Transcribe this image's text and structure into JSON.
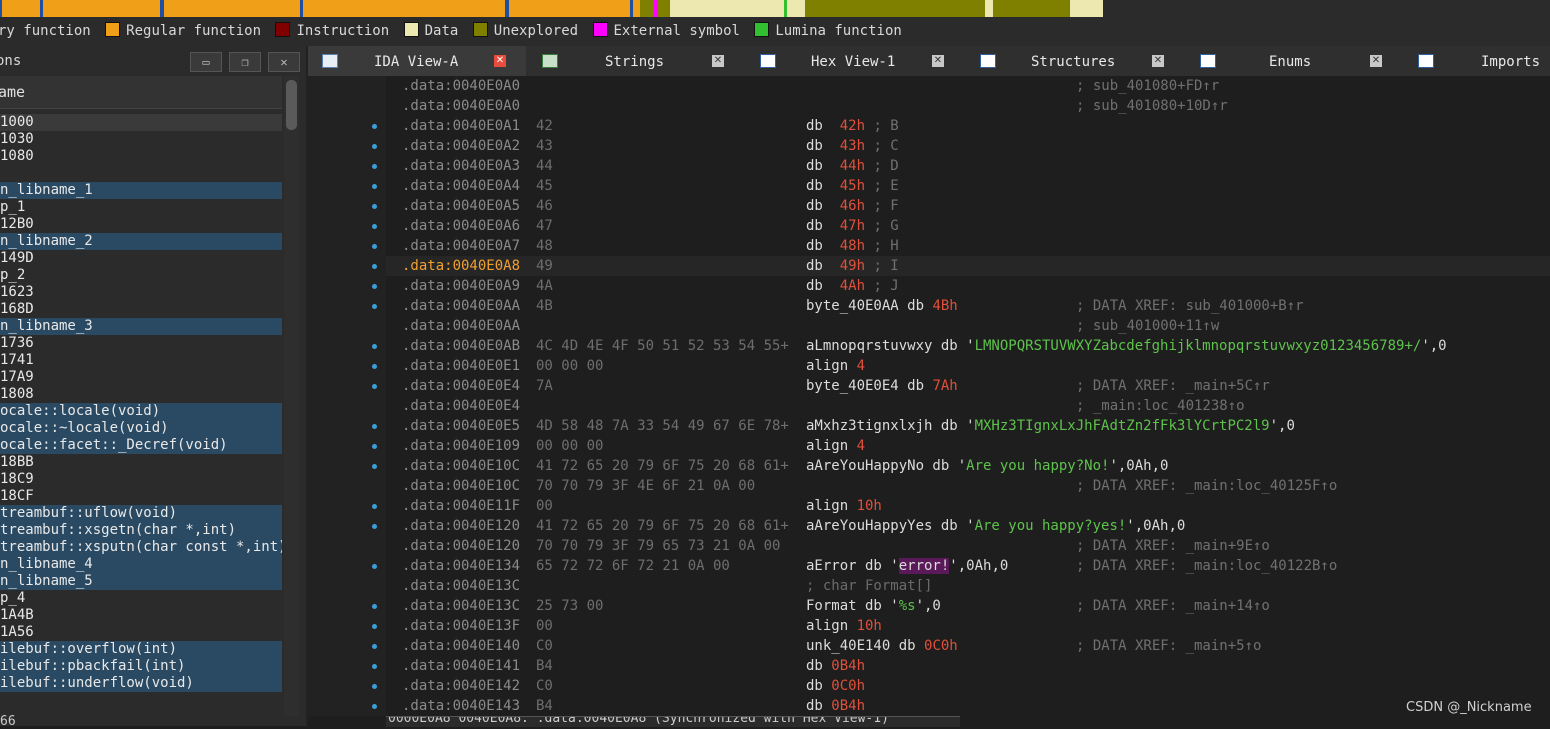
{
  "legend": {
    "items": [
      {
        "label": "ry function",
        "color": ""
      },
      {
        "label": "Regular function",
        "color": "#f0a018"
      },
      {
        "label": "Instruction",
        "color": "#800000"
      },
      {
        "label": "Data",
        "color": "#ece8b0"
      },
      {
        "label": "Unexplored",
        "color": "#808000"
      },
      {
        "label": "External symbol",
        "color": "#ff00ff"
      },
      {
        "label": "Lumina function",
        "color": "#30c030"
      }
    ]
  },
  "left_panel": {
    "title": "ons",
    "column_header": "ame",
    "rows": [
      {
        "text": "1000",
        "state": "cur"
      },
      {
        "text": "1030",
        "state": ""
      },
      {
        "text": "1080",
        "state": ""
      },
      {
        "text": "",
        "state": ""
      },
      {
        "text": "n_libname_1",
        "state": "sel"
      },
      {
        "text": "p_1",
        "state": ""
      },
      {
        "text": "12B0",
        "state": ""
      },
      {
        "text": "n_libname_2",
        "state": "sel"
      },
      {
        "text": "149D",
        "state": ""
      },
      {
        "text": "p_2",
        "state": ""
      },
      {
        "text": "1623",
        "state": ""
      },
      {
        "text": "168D",
        "state": ""
      },
      {
        "text": "n_libname_3",
        "state": "sel"
      },
      {
        "text": "1736",
        "state": ""
      },
      {
        "text": "1741",
        "state": ""
      },
      {
        "text": "17A9",
        "state": ""
      },
      {
        "text": "1808",
        "state": ""
      },
      {
        "text": "ocale::locale(void)",
        "state": "sel"
      },
      {
        "text": "ocale::~locale(void)",
        "state": "sel"
      },
      {
        "text": "ocale::facet::_Decref(void)",
        "state": "sel"
      },
      {
        "text": "18BB",
        "state": ""
      },
      {
        "text": "18C9",
        "state": ""
      },
      {
        "text": "18CF",
        "state": ""
      },
      {
        "text": "treambuf::uflow(void)",
        "state": "sel"
      },
      {
        "text": "treambuf::xsgetn(char *,int)",
        "state": "sel"
      },
      {
        "text": "treambuf::xsputn(char const *,int)",
        "state": "sel"
      },
      {
        "text": "n_libname_4",
        "state": "sel"
      },
      {
        "text": "n_libname_5",
        "state": "sel"
      },
      {
        "text": "p_4",
        "state": ""
      },
      {
        "text": "1A4B",
        "state": ""
      },
      {
        "text": "1A56",
        "state": ""
      },
      {
        "text": "ilebuf::overflow(int)",
        "state": "sel"
      },
      {
        "text": "ilebuf::pbackfail(int)",
        "state": "sel"
      },
      {
        "text": "ilebuf::underflow(void)",
        "state": "sel"
      }
    ],
    "bottom_text": "66"
  },
  "tabs": [
    {
      "label": "IDA View-A",
      "active": true
    },
    {
      "label": "Strings",
      "active": false
    },
    {
      "label": "Hex View-1",
      "active": false
    },
    {
      "label": "Structures",
      "active": false
    },
    {
      "label": "Enums",
      "active": false
    },
    {
      "label": "Imports",
      "active": false
    }
  ],
  "listing": [
    {
      "addr": ".data:0040E0A0",
      "bytes": "",
      "ins": "",
      "cmt": "; sub_401080+FD↑r",
      "dot": false
    },
    {
      "addr": ".data:0040E0A0",
      "bytes": "",
      "ins": "",
      "cmt": "; sub_401080+10D↑r",
      "dot": false
    },
    {
      "addr": ".data:0040E0A1",
      "bytes": "42",
      "ins": "db  42h ; B",
      "cmt": "",
      "dot": true
    },
    {
      "addr": ".data:0040E0A2",
      "bytes": "43",
      "ins": "db  43h ; C",
      "cmt": "",
      "dot": true
    },
    {
      "addr": ".data:0040E0A3",
      "bytes": "44",
      "ins": "db  44h ; D",
      "cmt": "",
      "dot": true
    },
    {
      "addr": ".data:0040E0A4",
      "bytes": "45",
      "ins": "db  45h ; E",
      "cmt": "",
      "dot": true
    },
    {
      "addr": ".data:0040E0A5",
      "bytes": "46",
      "ins": "db  46h ; F",
      "cmt": "",
      "dot": true
    },
    {
      "addr": ".data:0040E0A6",
      "bytes": "47",
      "ins": "db  47h ; G",
      "cmt": "",
      "dot": true
    },
    {
      "addr": ".data:0040E0A7",
      "bytes": "48",
      "ins": "db  48h ; H",
      "cmt": "",
      "dot": true
    },
    {
      "addr": ".data:0040E0A8",
      "bytes": "49",
      "ins": "db  49h ; I",
      "cmt": "",
      "dot": true
    },
    {
      "addr": ".data:0040E0A9",
      "bytes": "4A",
      "ins": "db  4Ah ; J",
      "cmt": "",
      "dot": true
    },
    {
      "addr": ".data:0040E0AA",
      "bytes": "4B",
      "ins": "byte_40E0AA db 4Bh",
      "cmt": "; DATA XREF: sub_401000+B↑r",
      "dot": true
    },
    {
      "addr": ".data:0040E0AA",
      "bytes": "",
      "ins": "",
      "cmt": "; sub_401000+11↑w",
      "dot": false
    },
    {
      "addr": ".data:0040E0AB",
      "bytes": "4C 4D 4E 4F 50 51 52 53 54 55+",
      "ins": "aLmnopqrstuvwxy db 'LMNOPQRSTUVWXYZabcdefghijklmnopqrstuvwxyz0123456789+/',0",
      "cmt": "",
      "dot": true
    },
    {
      "addr": ".data:0040E0E1",
      "bytes": "00 00 00",
      "ins": "align 4",
      "cmt": "",
      "dot": true
    },
    {
      "addr": ".data:0040E0E4",
      "bytes": "7A",
      "ins": "byte_40E0E4 db 7Ah",
      "cmt": "; DATA XREF: _main+5C↑r",
      "dot": true
    },
    {
      "addr": ".data:0040E0E4",
      "bytes": "",
      "ins": "",
      "cmt": "; _main:loc_401238↑o",
      "dot": false
    },
    {
      "addr": ".data:0040E0E5",
      "bytes": "4D 58 48 7A 33 54 49 67 6E 78+",
      "ins": "aMxhz3tignxlxjh db 'MXHz3TIgnxLxJhFAdtZn2fFk3lYCrtPC2l9',0",
      "cmt": "",
      "dot": true
    },
    {
      "addr": ".data:0040E109",
      "bytes": "00 00 00",
      "ins": "align 4",
      "cmt": "",
      "dot": true
    },
    {
      "addr": ".data:0040E10C",
      "bytes": "41 72 65 20 79 6F 75 20 68 61+",
      "ins": "aAreYouHappyNo db 'Are you happy?No!',0Ah,0",
      "cmt": "",
      "dot": true
    },
    {
      "addr": ".data:0040E10C",
      "bytes": "70 70 79 3F 4E 6F 21 0A 00",
      "ins": "",
      "cmt": "; DATA XREF: _main:loc_40125F↑o",
      "dot": false
    },
    {
      "addr": ".data:0040E11F",
      "bytes": "00",
      "ins": "align 10h",
      "cmt": "",
      "dot": true
    },
    {
      "addr": ".data:0040E120",
      "bytes": "41 72 65 20 79 6F 75 20 68 61+",
      "ins": "aAreYouHappyYes db 'Are you happy?yes!',0Ah,0",
      "cmt": "",
      "dot": true
    },
    {
      "addr": ".data:0040E120",
      "bytes": "70 70 79 3F 79 65 73 21 0A 00",
      "ins": "",
      "cmt": "; DATA XREF: _main+9E↑o",
      "dot": false
    },
    {
      "addr": ".data:0040E134",
      "bytes": "65 72 72 6F 72 21 0A 00",
      "ins": "aError db 'error!',0Ah,0",
      "cmt": "; DATA XREF: _main:loc_40122B↑o",
      "dot": true
    },
    {
      "addr": ".data:0040E13C",
      "bytes": "",
      "ins": "; char Format[]",
      "cmt": "",
      "dot": false
    },
    {
      "addr": ".data:0040E13C",
      "bytes": "25 73 00",
      "ins": "Format db '%s',0",
      "cmt": "; DATA XREF: _main+14↑o",
      "dot": true
    },
    {
      "addr": ".data:0040E13F",
      "bytes": "00",
      "ins": "align 10h",
      "cmt": "",
      "dot": true
    },
    {
      "addr": ".data:0040E140",
      "bytes": "C0",
      "ins": "unk_40E140 db 0C0h",
      "cmt": "; DATA XREF: _main+5↑o",
      "dot": true
    },
    {
      "addr": ".data:0040E141",
      "bytes": "B4",
      "ins": "db 0B4h",
      "cmt": "",
      "dot": true
    },
    {
      "addr": ".data:0040E142",
      "bytes": "C0",
      "ins": "db 0C0h",
      "cmt": "",
      "dot": true
    },
    {
      "addr": ".data:0040E143",
      "bytes": "B4",
      "ins": "db 0B4h",
      "cmt": "",
      "dot": true
    }
  ],
  "current_row": 9,
  "status": {
    "text": "0000E0A8 0040E0A8: .data:0040E0A8 (Synchronized with Hex View-1)"
  },
  "watermark": "CSDN @_Nickname"
}
